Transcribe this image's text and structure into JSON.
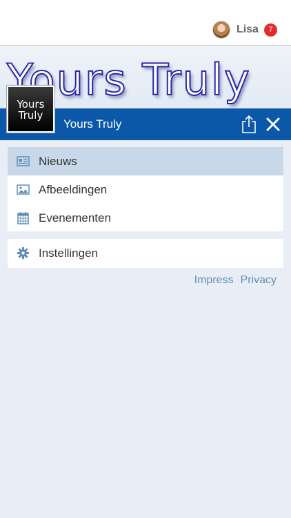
{
  "user": {
    "name": "Lisa",
    "notification_count": "7"
  },
  "brand": {
    "banner_text": "Yours Truly",
    "logo_line1": "Yours",
    "logo_line2": "Truly",
    "title": "Yours Truly"
  },
  "header_icons": {
    "share": "share-icon",
    "close": "close-icon"
  },
  "menu": {
    "items": [
      {
        "label": "Nieuws",
        "icon": "newspaper-icon",
        "active": true
      },
      {
        "label": "Afbeeldingen",
        "icon": "image-icon",
        "active": false
      },
      {
        "label": "Evenementen",
        "icon": "calendar-icon",
        "active": false
      }
    ],
    "settings": {
      "label": "Instellingen",
      "icon": "gear-icon"
    }
  },
  "footer": {
    "impress": "Impress",
    "privacy": "Privacy"
  },
  "colors": {
    "primary": "#0b57a8",
    "active_item": "#c8d8e8",
    "icon": "#5f8fb5",
    "badge": "#e42b2b",
    "background": "#e9eef6"
  }
}
